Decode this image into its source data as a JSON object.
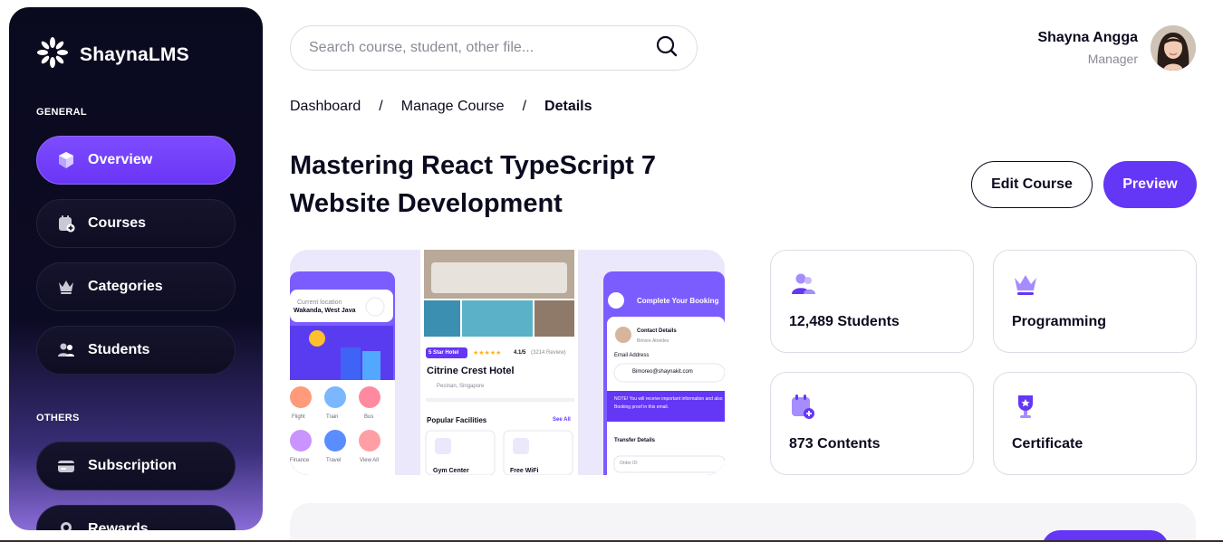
{
  "brand": {
    "name": "ShaynaLMS"
  },
  "sidebar": {
    "general_label": "GENERAL",
    "others_label": "OTHERS",
    "items": [
      {
        "label": "Overview",
        "icon": "cube-icon",
        "active": true
      },
      {
        "label": "Courses",
        "icon": "calendar-add-icon",
        "active": false
      },
      {
        "label": "Categories",
        "icon": "crown-icon",
        "active": false
      },
      {
        "label": "Students",
        "icon": "users-icon",
        "active": false
      }
    ],
    "other_items": [
      {
        "label": "Subscription",
        "icon": "card-icon",
        "active": false
      },
      {
        "label": "Rewards",
        "icon": "medal-icon",
        "active": false
      }
    ]
  },
  "search": {
    "placeholder": "Search course, student, other file...",
    "value": ""
  },
  "user": {
    "name": "Shayna Angga",
    "role": "Manager"
  },
  "breadcrumb": {
    "items": [
      "Dashboard",
      "Manage Course",
      "Details"
    ],
    "separator": "/"
  },
  "course": {
    "title_line1": "Mastering React TypeScript 7",
    "title_line2": "Website Development",
    "edit_label": "Edit Course",
    "preview_label": "Preview"
  },
  "thumbnail": {
    "location_label": "Current location",
    "location_value": "Wakanda, West Java",
    "categories": [
      "Flight",
      "Train",
      "Bus",
      "Finance",
      "Travel",
      "View All"
    ],
    "hotel_badge": "5 Star Hotel",
    "rating": "4.1/5",
    "reviews": "(3214 Review)",
    "hotel_name": "Citrine Crest Hotel",
    "hotel_location": "Pecinan, Singapore",
    "facilities_title": "Popular Facilities",
    "see_all": "See All",
    "facilities": [
      "Gym Center",
      "Free WiFi"
    ],
    "booking_title": "Complete Your Booking",
    "contact_title": "Contact Details",
    "contact_name": "Bimore Atreides",
    "email_label": "Email Address",
    "email_value": "Bimoreo@shaynakit.com",
    "note": "NOTE! You will receive important information and also Booking proof in this email.",
    "transfer_title": "Transfer Details",
    "order_label": "Order ID:"
  },
  "stats": [
    {
      "label": "12,489 Students",
      "icon": "users-icon"
    },
    {
      "label": "Programming",
      "icon": "crown-icon"
    },
    {
      "label": "873 Contents",
      "icon": "calendar-add-icon"
    },
    {
      "label": "Certificate",
      "icon": "trophy-icon"
    }
  ],
  "colors": {
    "primary": "#6436f5",
    "sidebar": "#0a0a1f",
    "accent_light": "#a58cff"
  }
}
